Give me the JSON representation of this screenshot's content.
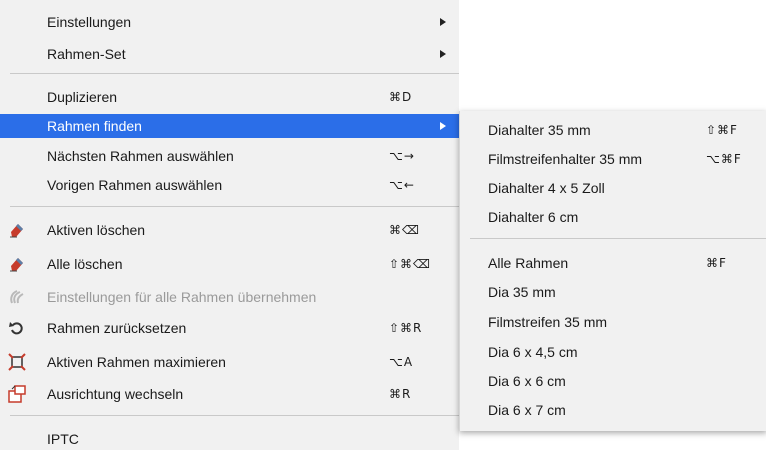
{
  "menu": {
    "einstellungen": {
      "label": "Einstellungen"
    },
    "rahmen_set": {
      "label": "Rahmen-Set"
    },
    "duplizieren": {
      "label": "Duplizieren",
      "shortcut": "⌘D"
    },
    "rahmen_finden": {
      "label": "Rahmen finden"
    },
    "naechsten": {
      "label": "Nächsten Rahmen auswählen",
      "shortcut": "⌥→"
    },
    "vorigen": {
      "label": "Vorigen Rahmen auswählen",
      "shortcut": "⌥←"
    },
    "aktiven_loeschen": {
      "label": "Aktiven löschen",
      "shortcut": "⌘⌫",
      "icon": "eraser-icon"
    },
    "alle_loeschen": {
      "label": "Alle löschen",
      "shortcut": "⇧⌘⌫",
      "icon": "eraser-icon"
    },
    "einst_alle": {
      "label": "Einstellungen für alle Rahmen übernehmen",
      "icon": "apply-all-icon"
    },
    "zuruecksetzen": {
      "label": "Rahmen zurücksetzen",
      "shortcut": "⇧⌘R",
      "icon": "reset-icon"
    },
    "maximieren": {
      "label": "Aktiven Rahmen maximieren",
      "shortcut": "⌥A",
      "icon": "maximize-icon"
    },
    "ausrichtung": {
      "label": "Ausrichtung wechseln",
      "shortcut": "⌘R",
      "icon": "rotate-orientation-icon"
    },
    "iptc": {
      "label": "IPTC"
    }
  },
  "submenu": {
    "diahalter35": {
      "label": "Diahalter 35 mm",
      "shortcut": "⇧⌘F"
    },
    "filmstreifenhalter35": {
      "label": "Filmstreifenhalter 35 mm",
      "shortcut": "⌥⌘F"
    },
    "diahalter4x5": {
      "label": "Diahalter 4 x 5 Zoll"
    },
    "diahalter6": {
      "label": "Diahalter 6 cm"
    },
    "alle_rahmen": {
      "label": "Alle Rahmen",
      "shortcut": "⌘F"
    },
    "dia35": {
      "label": "Dia 35 mm"
    },
    "filmstreifen35": {
      "label": "Filmstreifen 35 mm"
    },
    "dia6x45": {
      "label": "Dia 6 x 4,5 cm"
    },
    "dia6x6": {
      "label": "Dia 6 x 6 cm"
    },
    "dia6x7": {
      "label": "Dia 6 x 7 cm"
    }
  },
  "colors": {
    "selection": "#2b6ee8",
    "menu_bg": "#f1f1f1",
    "disabled_text": "#9a9a9a"
  }
}
